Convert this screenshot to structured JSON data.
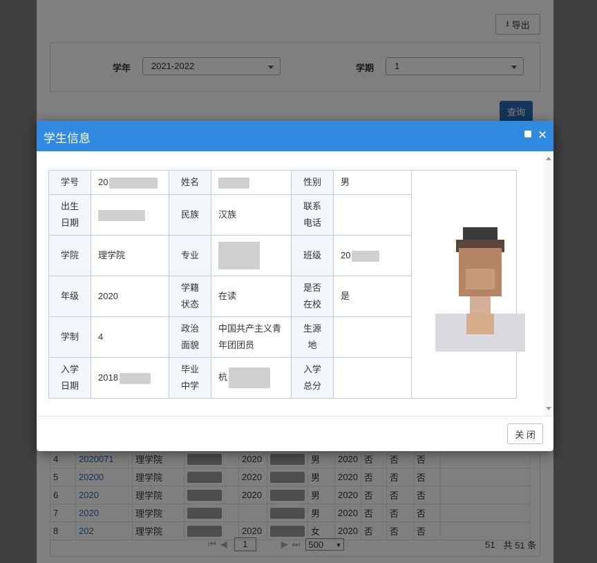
{
  "toolbar": {
    "export_label": "导出",
    "export_icon": "export-icon"
  },
  "filters": {
    "year_label": "学年",
    "year_value": "2021-2022",
    "term_label": "学期",
    "term_value": "1",
    "query_label": "查询"
  },
  "bg_table": {
    "rows": [
      {
        "no": "4",
        "id": "2020071",
        "college": "理学院",
        "grade": "2020",
        "gender": "男",
        "year2": "2020",
        "f1": "否",
        "f2": "否",
        "f3": "否"
      },
      {
        "no": "5",
        "id": "20200",
        "college": "理学院",
        "grade": "2020",
        "gender": "男",
        "year2": "2020",
        "f1": "否",
        "f2": "否",
        "f3": "否"
      },
      {
        "no": "6",
        "id": "2020",
        "college": "理学院",
        "grade": "2020",
        "gender": "男",
        "year2": "2020",
        "f1": "否",
        "f2": "否",
        "f3": "否"
      },
      {
        "no": "7",
        "id": "2020",
        "college": "理学院",
        "grade": "",
        "gender": "男",
        "year2": "2020",
        "f1": "否",
        "f2": "否",
        "f3": "否"
      },
      {
        "no": "8",
        "id": "202",
        "college": "理学院",
        "grade": "2020",
        "gender": "女",
        "year2": "2020",
        "f1": "否",
        "f2": "否",
        "f3": "否"
      }
    ]
  },
  "pager": {
    "page": "1",
    "page_size": "500",
    "total_pages_fragment": "51",
    "total_label": "共 51 条"
  },
  "modal": {
    "title": "学生信息",
    "close_label": "关 闭",
    "fields": {
      "student_id_label": "学号",
      "student_id": "20",
      "name_label": "姓名",
      "gender_label": "性别",
      "gender": "男",
      "birth_label": "出生\n日期",
      "ethnicity_label": "民族",
      "ethnicity": "汉族",
      "phone_label": "联系\n电话",
      "college_label": "学院",
      "college": "理学院",
      "major_label": "专业",
      "class_label": "班级",
      "class": "20",
      "grade_label": "年级",
      "grade": "2020",
      "status_label": "学籍\n状态",
      "status": "在读",
      "on_campus_label": "是否\n在校",
      "on_campus": "是",
      "length_label": "学制",
      "length": "4",
      "political_label": "政治\n面貌",
      "political": "中国共产主义青年团团员",
      "origin_label": "生源\n地",
      "enroll_date_label": "入学\n日期",
      "enroll_date": "2018",
      "high_school_label": "毕业\n中学",
      "high_school": "杭",
      "score_label": "入学\n总分"
    }
  },
  "colors": {
    "header_blue": "#2f8ae0",
    "query_blue": "#2a6cb5",
    "border_blue": "#b9cde1"
  }
}
